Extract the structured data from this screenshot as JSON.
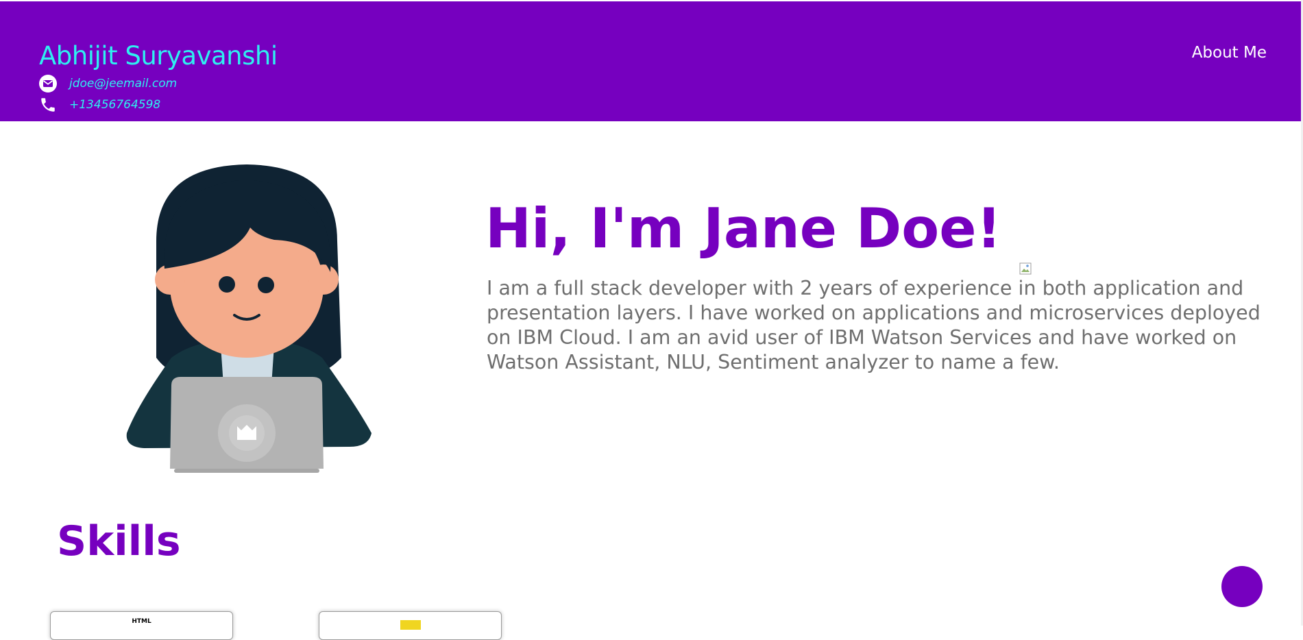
{
  "header": {
    "name": "Abhijit Suryavanshi",
    "email": "jdoe@jeemail.com",
    "phone": "+13456764598",
    "nav": {
      "about_label": "About Me"
    },
    "colors": {
      "background": "#7600bf",
      "name_text": "#2ef0f0",
      "nav_text": "#ffffff"
    }
  },
  "hero": {
    "illustration_icon": "developer-avatar-illustration",
    "title": "Hi, I'm Jane Doe!",
    "bio": "I am a full stack developer with 2 years of experience in both application and presentation layers. I have worked on applications and microservices deployed on IBM Cloud. I am an avid user of IBM Watson Services and have worked on Watson Assistant, NLU, Sentiment analyzer to name a few."
  },
  "skills": {
    "title": "Skills",
    "cards": [
      {
        "label": "HTML"
      },
      {
        "label": ""
      }
    ]
  },
  "fab": {
    "icon": "floating-action-circle",
    "color": "#7600bf"
  }
}
